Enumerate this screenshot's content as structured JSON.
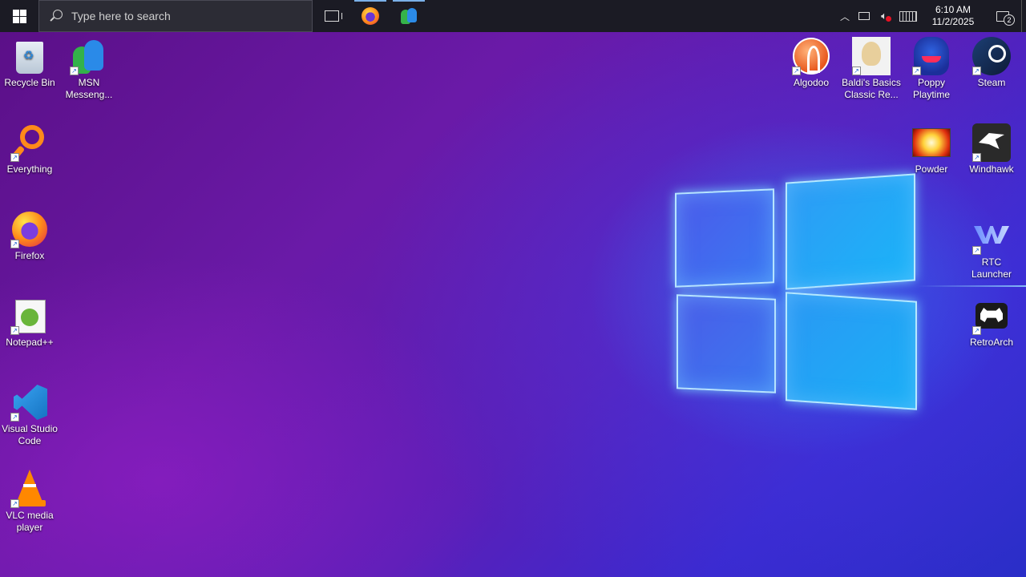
{
  "taskbar": {
    "search_placeholder": "Type here to search",
    "pinned": [
      {
        "name": "Task View",
        "icon": "task-view-icon"
      },
      {
        "name": "Firefox",
        "icon": "firefox-icon"
      },
      {
        "name": "MSN Messenger",
        "icon": "msn-messenger-icon"
      }
    ],
    "tray": {
      "time": "6:10 AM",
      "date": "11/2/2025",
      "notification_count": "2"
    }
  },
  "desktop": {
    "left_column": [
      {
        "label": "Recycle Bin",
        "icon": "recycle-bin-icon"
      },
      {
        "label": "MSN Messeng...",
        "icon": "msn-messenger-icon"
      },
      {
        "label": "Everything",
        "icon": "everything-icon"
      },
      {
        "label": "Firefox",
        "icon": "firefox-icon"
      },
      {
        "label": "Notepad++",
        "icon": "notepad-plus-plus-icon"
      },
      {
        "label": "Visual Studio Code",
        "icon": "vscode-icon"
      },
      {
        "label": "VLC media player",
        "icon": "vlc-icon"
      }
    ],
    "right_column": [
      {
        "label": "Algodoo",
        "icon": "algodoo-icon"
      },
      {
        "label": "Baldi's Basics Classic Re...",
        "icon": "baldis-basics-icon"
      },
      {
        "label": "Poppy Playtime",
        "icon": "poppy-playtime-icon"
      },
      {
        "label": "Steam",
        "icon": "steam-icon"
      },
      {
        "label": "Powder",
        "icon": "powder-icon"
      },
      {
        "label": "Windhawk",
        "icon": "windhawk-icon"
      },
      {
        "label": "RTC Launcher",
        "icon": "rtc-launcher-icon"
      },
      {
        "label": "RetroArch",
        "icon": "retroarch-icon"
      }
    ]
  },
  "colors": {
    "taskbar_bg": "#1b1b24",
    "wallpaper_primary": "#6a1aa8",
    "wallpaper_glow": "#1bb4f8"
  }
}
